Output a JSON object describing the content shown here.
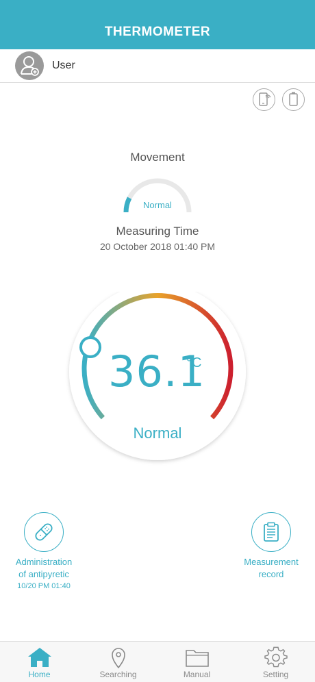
{
  "header": {
    "title": "THERMOMETER"
  },
  "user": {
    "name": "User"
  },
  "movement": {
    "label": "Movement",
    "status": "Normal",
    "level": 0.15
  },
  "measuring": {
    "label": "Measuring Time",
    "time": "20 October 2018 01:40 PM"
  },
  "temperature": {
    "value": "36.1",
    "unit": "°C",
    "status": "Normal"
  },
  "actions": {
    "left": {
      "line1": "Administration",
      "line2": "of antipyretic",
      "sub": "10/20 PM 01:40"
    },
    "right": {
      "line1": "Measurement",
      "line2": "record"
    }
  },
  "nav": [
    {
      "label": "Home",
      "icon": "home-icon",
      "active": true
    },
    {
      "label": "Searching",
      "icon": "location-pin-icon",
      "active": false
    },
    {
      "label": "Manual",
      "icon": "folder-icon",
      "active": false
    },
    {
      "label": "Setting",
      "icon": "gear-icon",
      "active": false
    }
  ],
  "colors": {
    "accent": "#3aafc5",
    "gauge_start": "#3aafc5",
    "gauge_mid": "#e8a22a",
    "gauge_end": "#cc1f2e"
  }
}
